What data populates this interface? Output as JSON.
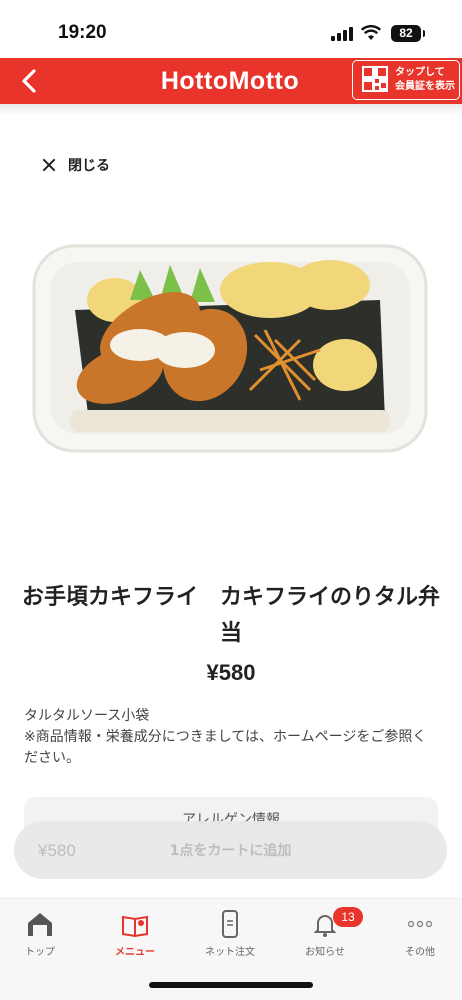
{
  "status_bar": {
    "time": "19:20",
    "battery": "82",
    "icons": [
      "signal-icon",
      "wifi-icon",
      "battery-icon"
    ]
  },
  "header": {
    "brand": "HottoMotto",
    "member_card_line1": "タップして",
    "member_card_line2": "会員証を表示",
    "back_icon": "chevron-left-icon",
    "qr_icon": "qr-code-icon",
    "colors": {
      "brand_red": "#e8342a"
    }
  },
  "close": {
    "label": "閉じる",
    "icon": "close-icon"
  },
  "product": {
    "image_icon": "bento-photo",
    "name": "お手頃カキフライ　カキフライのりタル弁当",
    "price": "¥580",
    "desc_line1": "タルタルソース小袋",
    "desc_line2": "※商品情報・栄養成分につきましては、ホームページをご参照ください。"
  },
  "allergen": {
    "label": "アレルゲン情報"
  },
  "cart": {
    "price": "¥580",
    "label": "1点をカートに追加"
  },
  "tabs": [
    {
      "label": "トップ",
      "icon": "home-icon"
    },
    {
      "label": "メニュー",
      "icon": "menu-book-icon",
      "active": true
    },
    {
      "label": "ネット注文",
      "icon": "smartphone-icon"
    },
    {
      "label": "お知らせ",
      "icon": "bell-icon",
      "badge": "13"
    },
    {
      "label": "その他",
      "icon": "more-icon"
    }
  ]
}
